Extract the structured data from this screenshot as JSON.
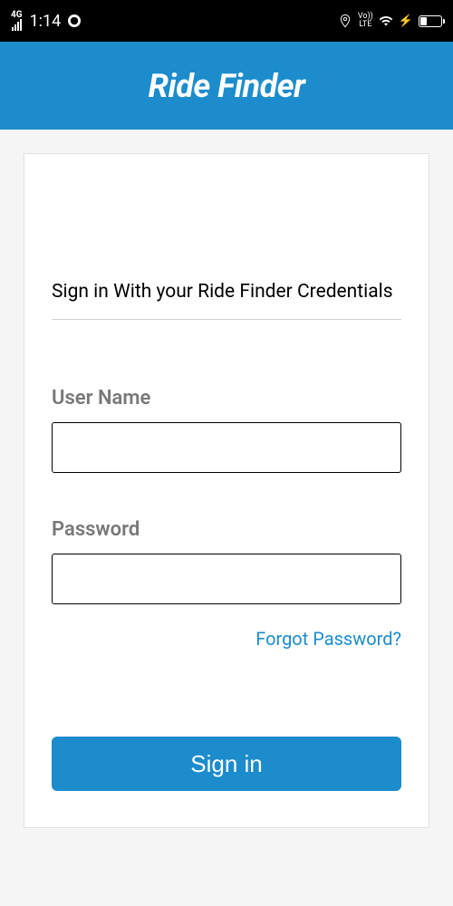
{
  "status_bar": {
    "network_type": "4G",
    "time": "1:14",
    "volte": "Vo))\nLTE"
  },
  "header": {
    "title": "Ride Finder"
  },
  "signin": {
    "title": "Sign in With your Ride Finder Credentials",
    "username_label": "User Name",
    "username_value": "",
    "password_label": "Password",
    "password_value": "",
    "forgot_link": "Forgot Password?",
    "signin_button": "Sign in"
  },
  "colors": {
    "primary": "#1c8ccc",
    "text_muted": "#787878"
  }
}
